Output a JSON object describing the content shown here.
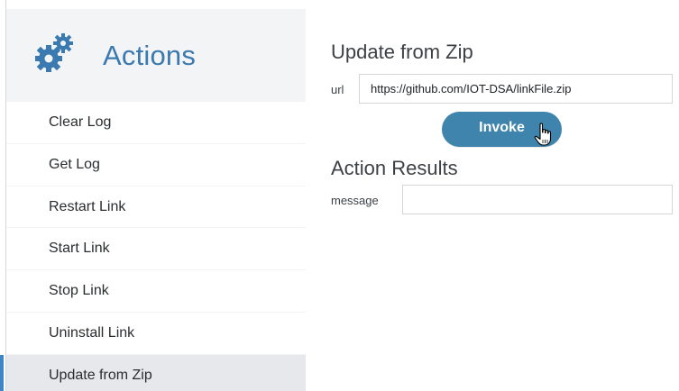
{
  "sidebar": {
    "title": "Actions",
    "header_icon": "gear-icon",
    "items": [
      {
        "label": "Clear Log",
        "active": false
      },
      {
        "label": "Get Log",
        "active": false
      },
      {
        "label": "Restart Link",
        "active": false
      },
      {
        "label": "Start Link",
        "active": false
      },
      {
        "label": "Stop Link",
        "active": false
      },
      {
        "label": "Uninstall Link",
        "active": false
      },
      {
        "label": "Update from Zip",
        "active": true
      }
    ]
  },
  "action": {
    "title": "Update from Zip",
    "url_label": "url",
    "url_value": "https://github.com/IOT-DSA/linkFile.zip",
    "invoke_label": "Invoke"
  },
  "results": {
    "title": "Action Results",
    "message_label": "message",
    "message_value": ""
  },
  "colors": {
    "accent": "#3a7ab0",
    "button": "#3f84ac",
    "active_marker": "#3f86c6",
    "sidebar_bg": "#f3f4f6"
  },
  "cursor": "pointer-hand-icon"
}
